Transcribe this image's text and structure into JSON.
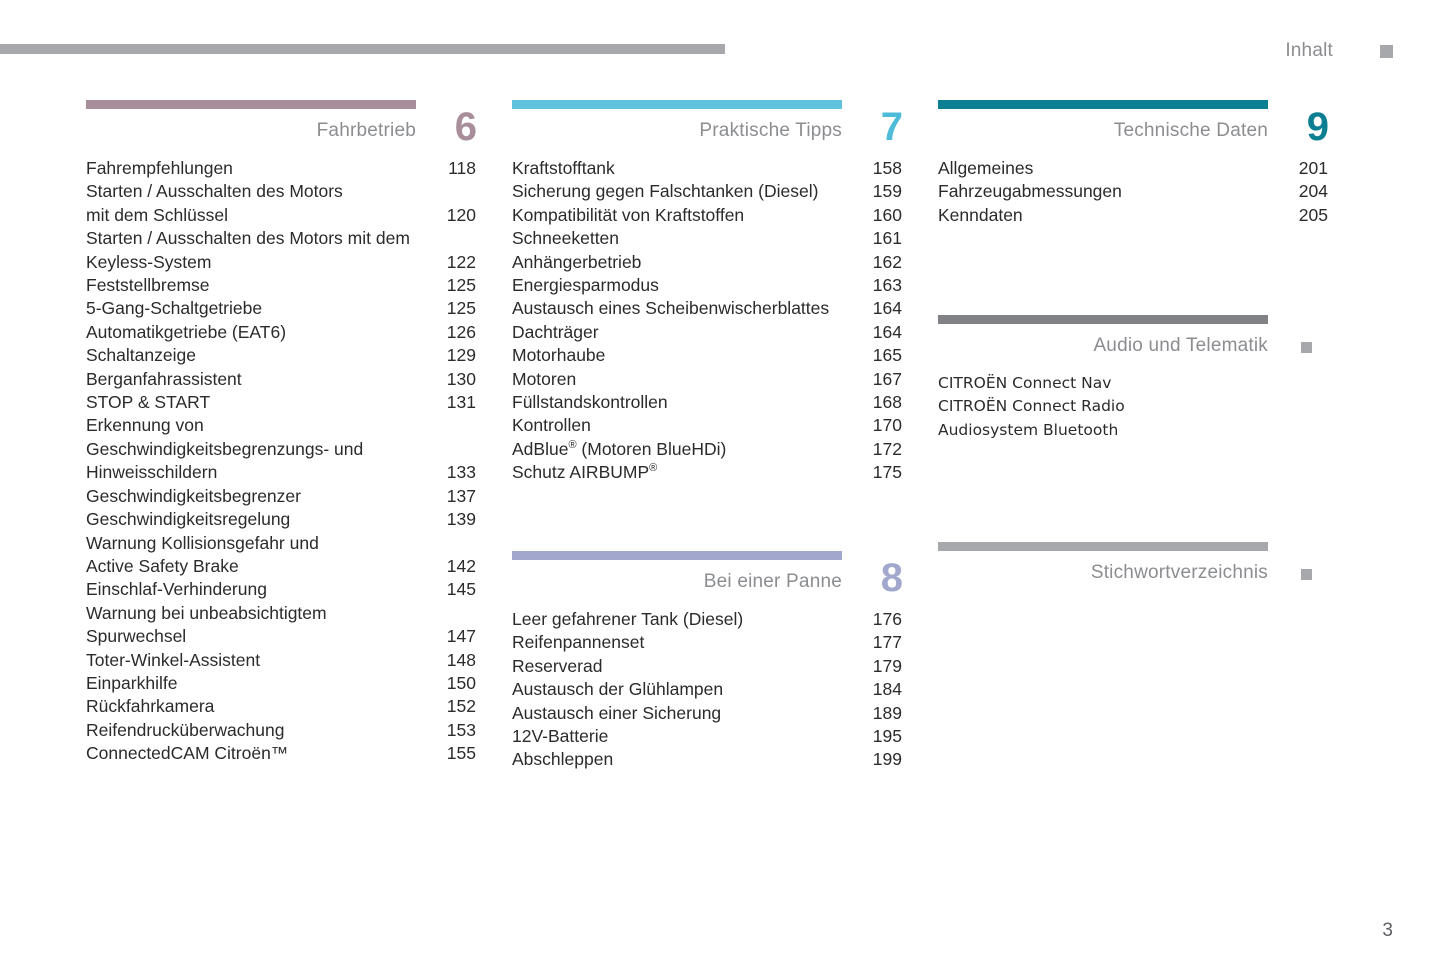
{
  "header": {
    "label": "Inhalt",
    "marker_color": "#a6a8ab",
    "rule_color": "#a6a8ab"
  },
  "footer": {
    "page_number": "3"
  },
  "colors": {
    "driving": "#a88e9b",
    "practical_tips": "#5fc3dd",
    "breakdown": "#a2a8cd",
    "technical_data": "#0d7f92",
    "gray": "#a6a8ab",
    "gray_dark": "#808286",
    "title_text": "#8b8d90",
    "body_text": "#2b2b2b"
  },
  "sections": [
    {
      "id": "fahrbetrieb",
      "title": "Fahrbetrieb",
      "number": "6",
      "bar_color": "#a88e9b",
      "number_color": "#a88e9b",
      "entries": [
        {
          "label": "Fahrempfehlungen",
          "page": "118"
        },
        {
          "label": "Starten / Ausschalten des Motors\nmit dem Schlüssel",
          "page": "120"
        },
        {
          "label": "Starten / Ausschalten des Motors mit dem\nKeyless-System",
          "page": "122"
        },
        {
          "label": "Feststellbremse",
          "page": "125"
        },
        {
          "label": "5-Gang-Schaltgetriebe",
          "page": "125"
        },
        {
          "label": "Automatikgetriebe (EAT6)",
          "page": "126"
        },
        {
          "label": "Schaltanzeige",
          "page": "129"
        },
        {
          "label": "Berganfahrassistent",
          "page": "130"
        },
        {
          "label": "STOP & START",
          "page": "131"
        },
        {
          "label": "Erkennung von\nGeschwindigkeitsbegrenzungs- und\nHinweisschildern",
          "page": "133"
        },
        {
          "label": "Geschwindigkeitsbegrenzer",
          "page": "137"
        },
        {
          "label": "Geschwindigkeitsregelung",
          "page": "139"
        },
        {
          "label": "Warnung Kollisionsgefahr und\nActive Safety Brake",
          "page": "142"
        },
        {
          "label": "Einschlaf-Verhinderung",
          "page": "145"
        },
        {
          "label": "Warnung bei unbeabsichtigtem\nSpurwechsel",
          "page": "147"
        },
        {
          "label": "Toter-Winkel-Assistent",
          "page": "148"
        },
        {
          "label": "Einparkhilfe",
          "page": "150"
        },
        {
          "label": "Rückfahrkamera",
          "page": "152"
        },
        {
          "label": "Reifendrucküberwachung",
          "page": "153"
        },
        {
          "label": "ConnectedCAM Citroën™",
          "page": "155"
        }
      ]
    },
    {
      "id": "praktische-tipps",
      "title": "Praktische Tipps",
      "number": "7",
      "bar_color": "#5fc3dd",
      "number_color": "#4ebcd8",
      "entries": [
        {
          "label": "Kraftstofftank",
          "page": "158"
        },
        {
          "label": "Sicherung gegen Falschtanken (Diesel)",
          "page": "159"
        },
        {
          "label": "Kompatibilität von Kraftstoffen",
          "page": "160"
        },
        {
          "label": "Schneeketten",
          "page": "161"
        },
        {
          "label": "Anhängerbetrieb",
          "page": "162"
        },
        {
          "label": "Energiesparmodus",
          "page": "163"
        },
        {
          "label": "Austausch eines Scheibenwischerblattes",
          "page": "164"
        },
        {
          "label": "Dachträger",
          "page": "164"
        },
        {
          "label": "Motorhaube",
          "page": "165"
        },
        {
          "label": "Motoren",
          "page": "167"
        },
        {
          "label": "Füllstandskontrollen",
          "page": "168"
        },
        {
          "label": "Kontrollen",
          "page": "170"
        },
        {
          "label": "AdBlue® (Motoren BlueHDi)",
          "page": "172"
        },
        {
          "label": "Schutz AIRBUMP®",
          "page": "175"
        }
      ]
    },
    {
      "id": "bei-einer-panne",
      "title": "Bei einer Panne",
      "number": "8",
      "bar_color": "#a2a8cd",
      "number_color": "#a2a8cd",
      "entries": [
        {
          "label": "Leer gefahrener Tank (Diesel)",
          "page": "176"
        },
        {
          "label": "Reifenpannenset",
          "page": "177"
        },
        {
          "label": "Reserverad",
          "page": "179"
        },
        {
          "label": "Austausch der Glühlampen",
          "page": "184"
        },
        {
          "label": "Austausch einer Sicherung",
          "page": "189"
        },
        {
          "label": "12V-Batterie",
          "page": "195"
        },
        {
          "label": "Abschleppen",
          "page": "199"
        }
      ]
    },
    {
      "id": "technische-daten",
      "title": "Technische Daten",
      "number": "9",
      "bar_color": "#0d7f92",
      "number_color": "#0d7f92",
      "entries": [
        {
          "label": "Allgemeines",
          "page": "201"
        },
        {
          "label": "Fahrzeugabmessungen",
          "page": "204"
        },
        {
          "label": "Kenndaten",
          "page": "205"
        }
      ]
    },
    {
      "id": "audio-und-telematik",
      "title": "Audio und Telematik",
      "number": "",
      "bar_color": "#808286",
      "marker_color": "#a6a8ab",
      "entries": [
        {
          "label": "CITROËN Connect Nav",
          "page": ""
        },
        {
          "label": "CITROËN Connect Radio",
          "page": ""
        },
        {
          "label": "Audiosystem Bluetooth",
          "page": ""
        }
      ]
    },
    {
      "id": "stichwortverzeichnis",
      "title": "Stichwortverzeichnis",
      "number": "",
      "bar_color": "#a6a8ab",
      "marker_color": "#a6a8ab",
      "entries": []
    }
  ]
}
